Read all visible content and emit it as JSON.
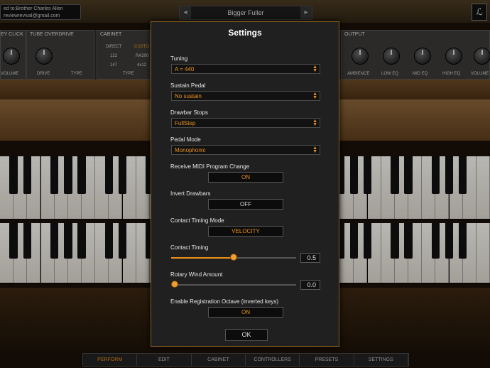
{
  "header": {
    "registration_line1": "ed to:Brother Charles Allen",
    "registration_line2": "reviewrevival@gmail.com",
    "preset_prev": "◂",
    "preset_name": "Bigger Fuller",
    "preset_next": "▸",
    "logo": "ℒ"
  },
  "panels": {
    "key_click": "EY CLICK",
    "tube_overdrive": "TUBE OVERDRIVE",
    "cabinet": "CABINET",
    "output": "OUTPUT",
    "cabinet_direct": "DIRECT",
    "cabinet_custom": "CUSTO",
    "cabinet_122": "122",
    "cabinet_ra200": "RA200",
    "cabinet_147": "147",
    "cabinet_4x12": "4x12",
    "volume": "VOLUME",
    "drive": "DRIVE",
    "type": "TYPE",
    "cab_type": "TYPE",
    "ambience": "AMBIENCE",
    "low_eq": "LOW EQ",
    "mid_eq": "MID EQ",
    "high_eq": "HIGH EQ",
    "volume_out": "VOLUME"
  },
  "dialog": {
    "title": "Settings",
    "tuning": {
      "label": "Tuning",
      "value": "A = 440"
    },
    "sustain_pedal": {
      "label": "Sustain Pedal",
      "value": "No sustain"
    },
    "drawbar_stops": {
      "label": "Drawbar Stops",
      "value": "FullStep"
    },
    "pedal_mode": {
      "label": "Pedal Mode",
      "value": "Monophonic"
    },
    "receive_midi": {
      "label": "Receive MIDI Program Change",
      "value": "ON"
    },
    "invert_drawbars": {
      "label": "Invert Drawbars",
      "value": "OFF"
    },
    "contact_timing_mode": {
      "label": "Contact Timing Mode",
      "value": "VELOCITY"
    },
    "contact_timing": {
      "label": "Contact Timing",
      "value": "0.5",
      "fraction": 0.5
    },
    "rotary_wind": {
      "label": "Rotary Wind Amount",
      "value": "0.0",
      "fraction": 0.0
    },
    "registration_octave": {
      "label": "Enable Registration Octave (inverted keys)",
      "value": "ON"
    },
    "ok_label": "OK"
  },
  "bottom_nav": {
    "perform": "PERFORM",
    "edit": "EDIT",
    "cabinet": "CABINET",
    "controllers": "CONTROLLERS",
    "presets": "PRESETS",
    "settings": "SETTINGS"
  },
  "colors": {
    "accent": "#e8921a",
    "dialog_border": "#8a5f22"
  }
}
